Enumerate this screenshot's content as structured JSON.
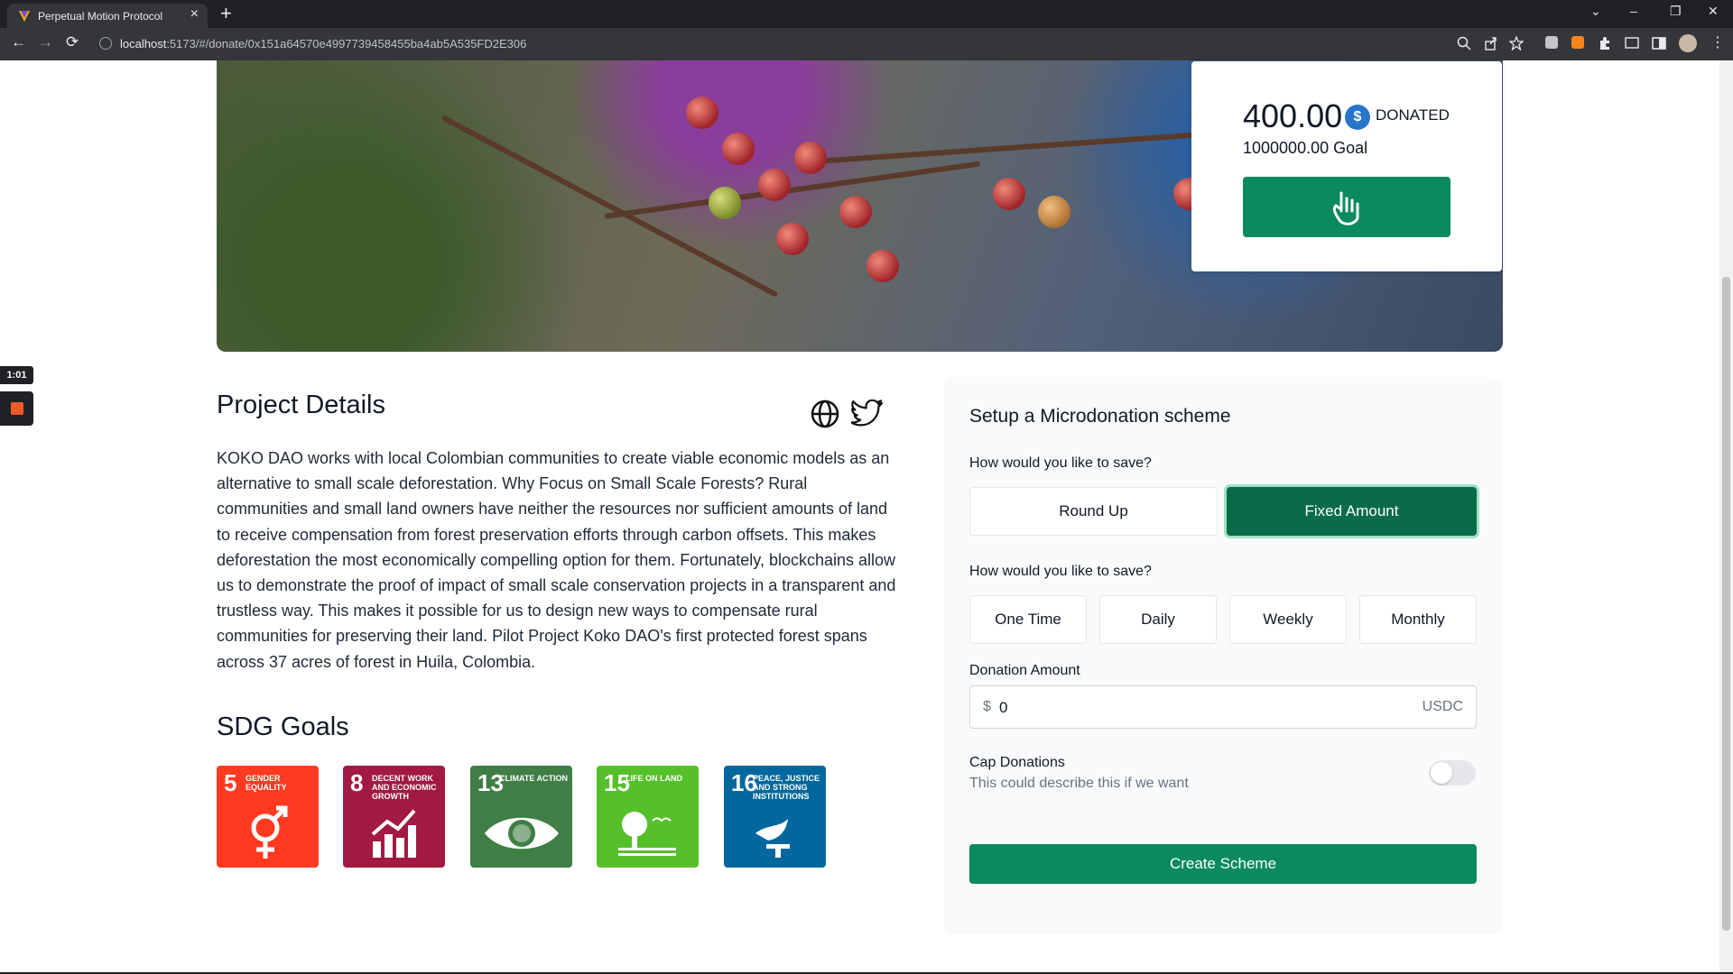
{
  "browser": {
    "tab_title": "Perpetual Motion Protocol",
    "tab_close": "×",
    "new_tab": "+",
    "url_host": "localhost",
    "url_rest": ":5173/#/donate/0x151a64570e4997739458455ba4ab5A535FD2E306",
    "back": "←",
    "forward": "→",
    "reload": "⟳",
    "win_chevron": "⌄",
    "win_min": "–",
    "win_max": "❐",
    "win_close": "✕"
  },
  "recorder": {
    "time": "1:01"
  },
  "donation": {
    "amount": "400.00",
    "coin_symbol": "$",
    "donated_label": "DONATED",
    "goal": "1000000.00 Goal"
  },
  "project": {
    "title": "Project Details",
    "description": "KOKO DAO works with local Colombian communities to create viable economic models as an alternative to small scale deforestation. Why Focus on Small Scale Forests? Rural communities and small land owners have neither the resources nor sufficient amounts of land to receive compensation from forest preservation efforts through carbon offsets. This makes deforestation the most economically compelling option for them. Fortunately, blockchains allow us to demonstrate the proof of impact of small scale conservation projects in a transparent and trustless way. This makes it possible for us to design new ways to compensate rural communities for preserving their land. Pilot Project Koko DAO's first protected forest spans across 37 acres of forest in Huila, Colombia."
  },
  "sdg": {
    "title": "SDG Goals",
    "goals": [
      {
        "num": "5",
        "label": "GENDER EQUALITY",
        "color": "#ff3a21"
      },
      {
        "num": "8",
        "label": "DECENT WORK AND ECONOMIC GROWTH",
        "color": "#a21942"
      },
      {
        "num": "13",
        "label": "CLIMATE ACTION",
        "color": "#3f7e44"
      },
      {
        "num": "15",
        "label": "LIFE ON LAND",
        "color": "#56c02b"
      },
      {
        "num": "16",
        "label": "PEACE, JUSTICE AND STRONG INSTITUTIONS",
        "color": "#00689d"
      }
    ]
  },
  "scheme": {
    "title": "Setup a Microdonation scheme",
    "question1": "How would you like to save?",
    "mode_options": [
      "Round Up",
      "Fixed Amount"
    ],
    "mode_selected": "Fixed Amount",
    "question2": "How would you like to save?",
    "frequency_options": [
      "One Time",
      "Daily",
      "Weekly",
      "Monthly"
    ],
    "amount_label": "Donation Amount",
    "amount_currency": "$",
    "amount_value": "0",
    "amount_unit": "USDC",
    "cap_title": "Cap Donations",
    "cap_description": "This could describe this if we want",
    "cap_enabled": false,
    "create_label": "Create Scheme"
  },
  "colors": {
    "accent": "#0a8a5e",
    "accent_dark": "#0a6b49",
    "usdc": "#2775ca"
  }
}
